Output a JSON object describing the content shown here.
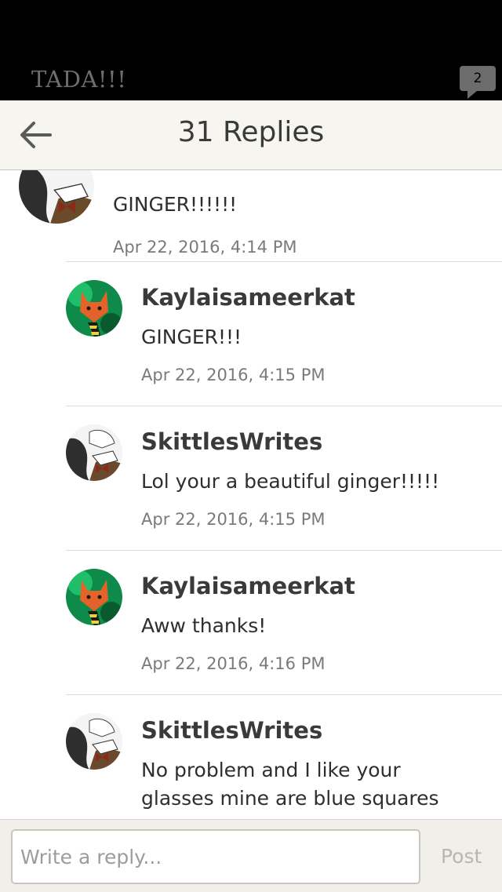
{
  "story": {
    "title": "TADA!!!",
    "comment_count": "2"
  },
  "header": {
    "title": "31 Replies",
    "back_icon": "arrow-left-icon"
  },
  "comments": [
    {
      "author": "",
      "avatar": "dog-avatar",
      "body": "GINGER!!!!!!",
      "time": "Apr 22, 2016, 4:14 PM"
    },
    {
      "author": "Kaylaisameerkat",
      "avatar": "fox-avatar",
      "body": "GINGER!!!",
      "time": "Apr 22, 2016, 4:15 PM"
    },
    {
      "author": "SkittlesWrites",
      "avatar": "dog-avatar",
      "body": "Lol your a beautiful ginger!!!!!",
      "time": "Apr 22, 2016, 4:15 PM"
    },
    {
      "author": "Kaylaisameerkat",
      "avatar": "fox-avatar",
      "body": "Aww thanks!",
      "time": "Apr 22, 2016, 4:16 PM"
    },
    {
      "author": "SkittlesWrites",
      "avatar": "dog-avatar",
      "body": "No problem and I like your glasses mine are blue squares",
      "time": ""
    }
  ],
  "composer": {
    "placeholder": "Write a reply...",
    "post_label": "Post"
  },
  "colors": {
    "header_bg": "#f7f5ef",
    "top_bar": "#000000",
    "bubble": "#6c6c6c"
  }
}
